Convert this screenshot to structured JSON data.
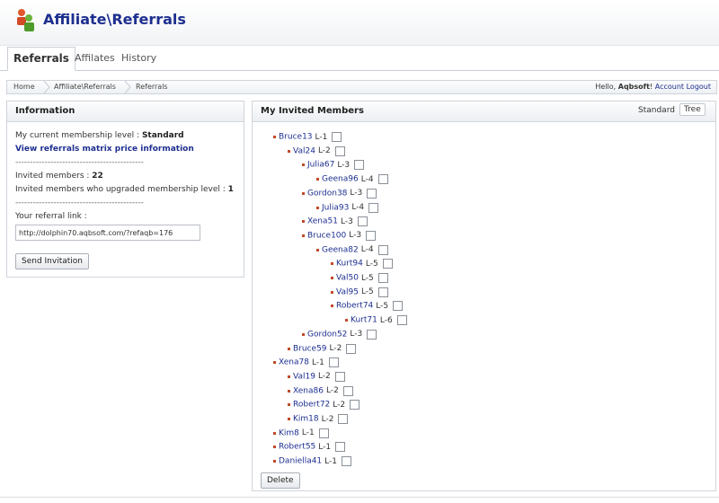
{
  "header": {
    "title": "Affiliate\\Referrals"
  },
  "tabs": [
    {
      "label": "Referrals",
      "active": true
    },
    {
      "label": "Affilates",
      "active": false
    },
    {
      "label": "History",
      "active": false
    }
  ],
  "breadcrumb": [
    "Home",
    "Affiliate\\Referrals",
    "Referrals"
  ],
  "user": {
    "greeting": "Hello, ",
    "name": "Aqbsoft",
    "excl": "!",
    "account": "Account",
    "logout": "Logout"
  },
  "info": {
    "title": "Information",
    "membership_prefix": "My current membership level : ",
    "membership_level": "Standard",
    "matrix_link": "View referrals matrix price information",
    "divider": "--------------------------------------------",
    "invited_prefix": "Invited members : ",
    "invited_count": "22",
    "upgraded_prefix": "Invited members who upgraded membership level : ",
    "upgraded_count": "1",
    "divider2": "--------------------------------------------",
    "referral_label": "Your referral link :",
    "referral_value": "http://dolphin70.aqbsoft.com/?refaqb=176",
    "send_button": "Send Invitation"
  },
  "members": {
    "title": "My Invited Members",
    "view_standard": "Standard",
    "view_tree": "Tree",
    "delete_button": "Delete",
    "tree": [
      {
        "name": "Bruce13",
        "level": "L-1"
      },
      {
        "name": "Val24",
        "level": "L-2"
      },
      {
        "name": "Julia67",
        "level": "L-3"
      },
      {
        "name": "Geena96",
        "level": "L-4"
      },
      {
        "name": "Gordon38",
        "level": "L-3"
      },
      {
        "name": "Julia93",
        "level": "L-4"
      },
      {
        "name": "Xena51",
        "level": "L-3"
      },
      {
        "name": "Bruce100",
        "level": "L-3"
      },
      {
        "name": "Geena82",
        "level": "L-4"
      },
      {
        "name": "Kurt94",
        "level": "L-5"
      },
      {
        "name": "Val50",
        "level": "L-5"
      },
      {
        "name": "Val95",
        "level": "L-5"
      },
      {
        "name": "Robert74",
        "level": "L-5"
      },
      {
        "name": "Kurt71",
        "level": "L-6"
      },
      {
        "name": "Gordon52",
        "level": "L-3"
      },
      {
        "name": "Bruce59",
        "level": "L-2"
      },
      {
        "name": "Xena78",
        "level": "L-1"
      },
      {
        "name": "Val19",
        "level": "L-2"
      },
      {
        "name": "Xena86",
        "level": "L-2"
      },
      {
        "name": "Robert72",
        "level": "L-2"
      },
      {
        "name": "Kim18",
        "level": "L-2"
      },
      {
        "name": "Kim8",
        "level": "L-1"
      },
      {
        "name": "Robert55",
        "level": "L-1"
      },
      {
        "name": "Daniella41",
        "level": "L-1"
      }
    ]
  }
}
